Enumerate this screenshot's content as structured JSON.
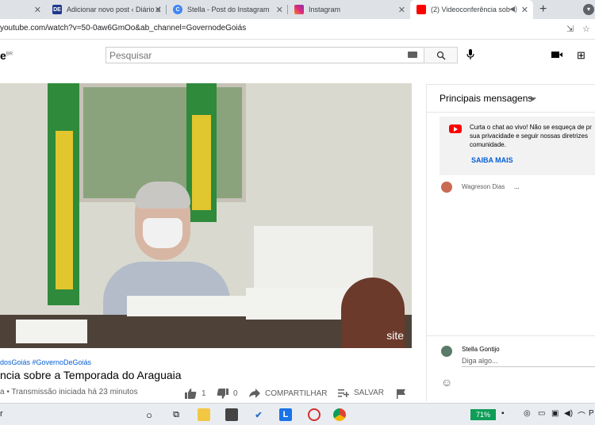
{
  "browser": {
    "tabs": [
      {
        "title": "Adicionar novo post ‹ Diário d",
        "icon_label": "DE",
        "icon_color": "#1e3a8a"
      },
      {
        "title": "Stella - Post do Instagram",
        "icon_label": "C",
        "icon_color": "#4285f4"
      },
      {
        "title": "Instagram",
        "icon_label": "",
        "icon_color": "#e1306c"
      },
      {
        "title": "(2) Videoconferência sob",
        "icon_label": "",
        "icon_color": "#ff0000"
      }
    ],
    "new_tab_label": "+",
    "url": "youtube.com/watch?v=50-0aw6GmOo&ab_channel=GovernodeGoiás"
  },
  "youtube": {
    "logo_text": "e",
    "logo_region": "BR",
    "search_placeholder": "Pesquisar"
  },
  "video": {
    "watermark": "site",
    "hashtags": "dosGoiás #GovernoDeGoiás",
    "title": "ncia sobre a Temporada do Araguaia",
    "info": "a • Transmissão iniciada há 23 minutos",
    "likes": "1",
    "dislikes": "0",
    "share_label": "COMPARTILHAR",
    "save_label": "SALVAR"
  },
  "chat": {
    "header": "Principais mensagens",
    "notice_text": "Curta o chat ao vivo! Não se esqueça de pr sua privacidade e seguir nossas diretrizes comunidade.",
    "learn_more": "SAIBA MAIS",
    "messages": [
      {
        "author": "Wagreson Dias",
        "text": "..."
      }
    ],
    "current_user": "Stella Gontijo",
    "input_placeholder": "Diga algo..."
  },
  "taskbar": {
    "search_fragment": "r",
    "battery": "71%",
    "tray_fragment": "P"
  }
}
